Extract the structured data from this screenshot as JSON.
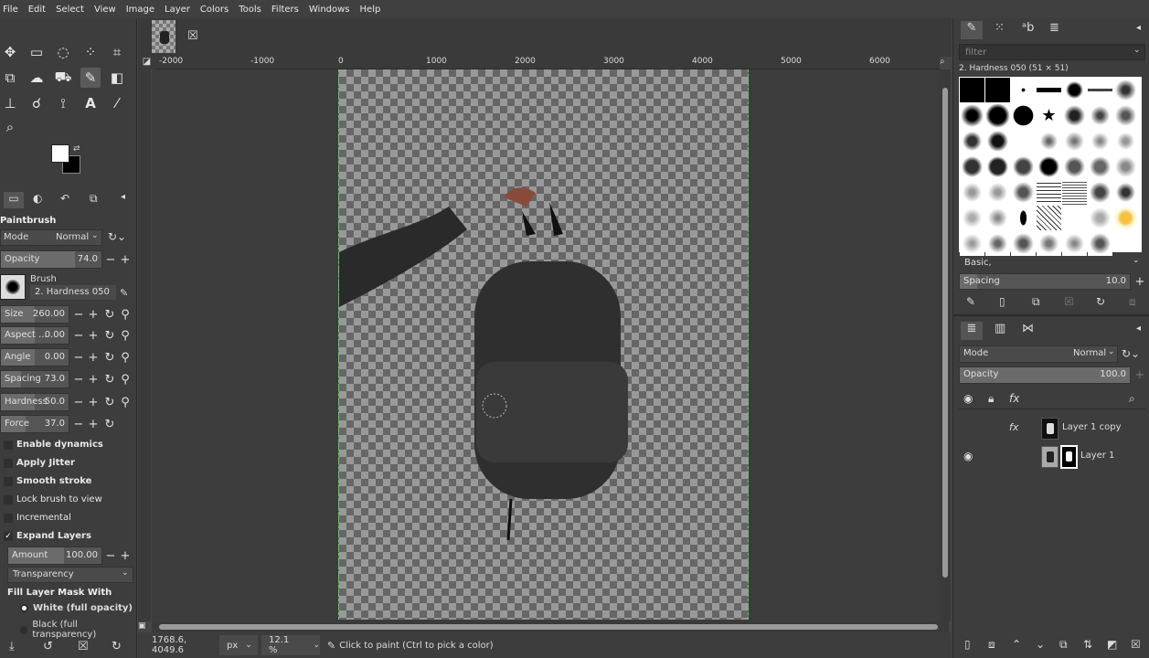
{
  "menu": [
    "File",
    "Edit",
    "Select",
    "View",
    "Image",
    "Layer",
    "Colors",
    "Tools",
    "Filters",
    "Windows",
    "Help"
  ],
  "tool_options": {
    "title": "Paintbrush",
    "mode_label": "Mode",
    "mode_value": "Normal",
    "opacity_label": "Opacity",
    "opacity_value": "74.0",
    "brush_label": "Brush",
    "brush_name": "2. Hardness 050",
    "size_label": "Size",
    "size_value": "260.00",
    "aspect_label": "Aspect ...",
    "aspect_value": "0.00",
    "angle_label": "Angle",
    "angle_value": "0.00",
    "spacing_label": "Spacing",
    "spacing_value": "73.0",
    "hardness_label": "Hardness",
    "hardness_value": "50.0",
    "force_label": "Force",
    "force_value": "37.0",
    "enable_dynamics": "Enable dynamics",
    "apply_jitter": "Apply Jitter",
    "smooth_stroke": "Smooth stroke",
    "lock_brush": "Lock brush to view",
    "incremental": "Incremental",
    "expand_layers": "Expand Layers",
    "amount_label": "Amount",
    "amount_value": "100.00",
    "fill_type": "Transparency",
    "fill_mask_title": "Fill Layer Mask With",
    "white_option": "White (full opacity)",
    "black_option": "Black (full transparency)"
  },
  "ruler_top": [
    "-2000",
    "-1000",
    "0",
    "1000",
    "2000",
    "3000",
    "4000",
    "5000",
    "6000"
  ],
  "status": {
    "coords": "1768.6, 4049.6",
    "unit": "px",
    "zoom": "12.1 %",
    "message": "Click to paint (Ctrl to pick a color)"
  },
  "brushes_panel": {
    "filter_placeholder": "filter",
    "selected_brush": "2. Hardness 050 (51 × 51)",
    "tag": "Basic,",
    "spacing_label": "Spacing",
    "spacing_value": "10.0"
  },
  "layers_panel": {
    "mode_label": "Mode",
    "mode_value": "Normal",
    "opacity_label": "Opacity",
    "opacity_value": "100.0",
    "layers": [
      {
        "name": "Layer 1 copy",
        "visible": false
      },
      {
        "name": "Layer 1",
        "visible": true
      }
    ]
  },
  "colors": {
    "accent": "#6c6",
    "bg": "#454545"
  }
}
